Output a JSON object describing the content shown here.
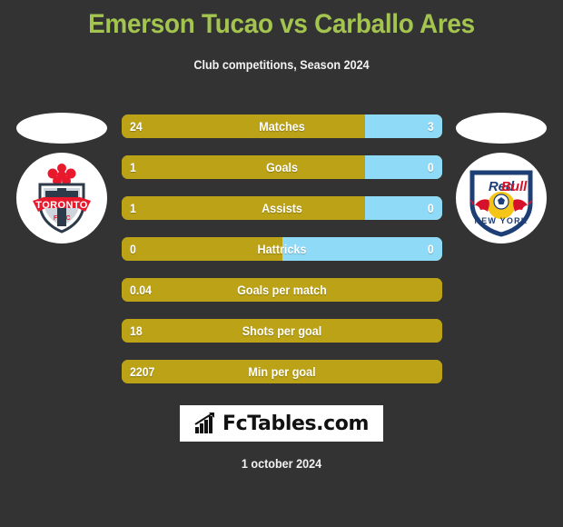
{
  "header": {
    "title": "Emerson Tucao vs Carballo Ares",
    "subtitle": "Club competitions, Season 2024",
    "title_color": "#a3c54f"
  },
  "teams": {
    "home": {
      "badge_name": "toronto-fc-badge",
      "badge_text": "TORONTO",
      "badge_subtext": "F C"
    },
    "away": {
      "badge_name": "new-york-red-bulls-badge",
      "badge_text": "RedBull",
      "badge_subtext": "NEW YORK"
    }
  },
  "colors": {
    "background": "#333333",
    "home_bar": "#bba216",
    "away_bar": "#8fdbf7",
    "text": "#ffffff"
  },
  "chart_data": {
    "type": "bar",
    "title": "Emerson Tucao vs Carballo Ares",
    "subtitle": "Club competitions, Season 2024",
    "orientation": "horizontal-paired",
    "series": [
      {
        "name": "Emerson Tucao",
        "color": "#bba216",
        "align": "left"
      },
      {
        "name": "Carballo Ares",
        "color": "#8fdbf7",
        "align": "right"
      }
    ],
    "categories": [
      "Matches",
      "Goals",
      "Assists",
      "Hattricks",
      "Goals per match",
      "Shots per goal",
      "Min per goal"
    ],
    "rows": [
      {
        "label": "Matches",
        "home": "24",
        "away": "3",
        "home_pct": 76,
        "away_pct": 24,
        "split": true
      },
      {
        "label": "Goals",
        "home": "1",
        "away": "0",
        "home_pct": 76,
        "away_pct": 24,
        "split": true
      },
      {
        "label": "Assists",
        "home": "1",
        "away": "0",
        "home_pct": 76,
        "away_pct": 24,
        "split": true
      },
      {
        "label": "Hattricks",
        "home": "0",
        "away": "0",
        "home_pct": 50,
        "away_pct": 50,
        "split": true
      },
      {
        "label": "Goals per match",
        "home": "0.04",
        "away": "",
        "home_pct": 100,
        "away_pct": 0,
        "split": false
      },
      {
        "label": "Shots per goal",
        "home": "18",
        "away": "",
        "home_pct": 100,
        "away_pct": 0,
        "split": false
      },
      {
        "label": "Min per goal",
        "home": "2207",
        "away": "",
        "home_pct": 100,
        "away_pct": 0,
        "split": false
      }
    ]
  },
  "footer": {
    "logo_text": "FcTables.com",
    "logo_icon": "bar-chart-growth-icon",
    "date": "1 october 2024"
  }
}
